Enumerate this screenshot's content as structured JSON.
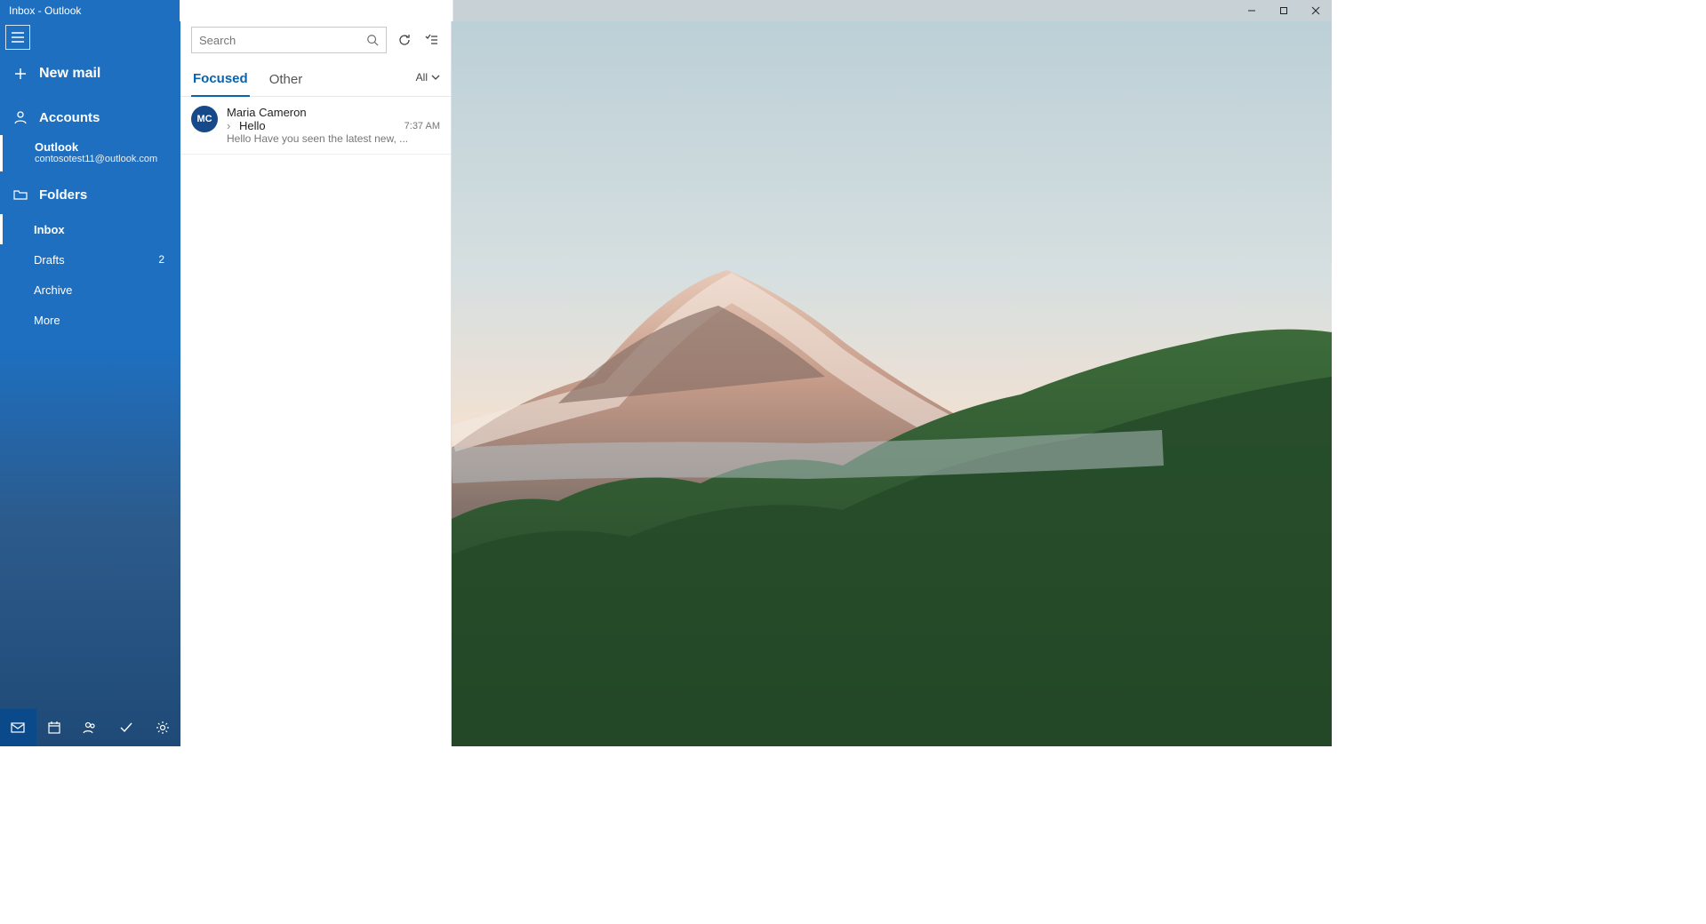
{
  "window": {
    "title": "Inbox - Outlook"
  },
  "sidebar": {
    "new_mail": "New mail",
    "accounts_label": "Accounts",
    "account": {
      "name": "Outlook",
      "email": "contosotest11@outlook.com"
    },
    "folders_label": "Folders",
    "folders": [
      {
        "name": "Inbox",
        "count": "",
        "selected": true
      },
      {
        "name": "Drafts",
        "count": "2",
        "selected": false
      },
      {
        "name": "Archive",
        "count": "",
        "selected": false
      },
      {
        "name": "More",
        "count": "",
        "selected": false
      }
    ]
  },
  "list": {
    "search_placeholder": "Search",
    "tab_focused": "Focused",
    "tab_other": "Other",
    "filter_label": "All",
    "messages": [
      {
        "initials": "MC",
        "sender": "Maria Cameron",
        "subject": "Hello",
        "preview": "Hello Have you seen the latest new, ...",
        "time": "7:37 AM"
      }
    ]
  }
}
